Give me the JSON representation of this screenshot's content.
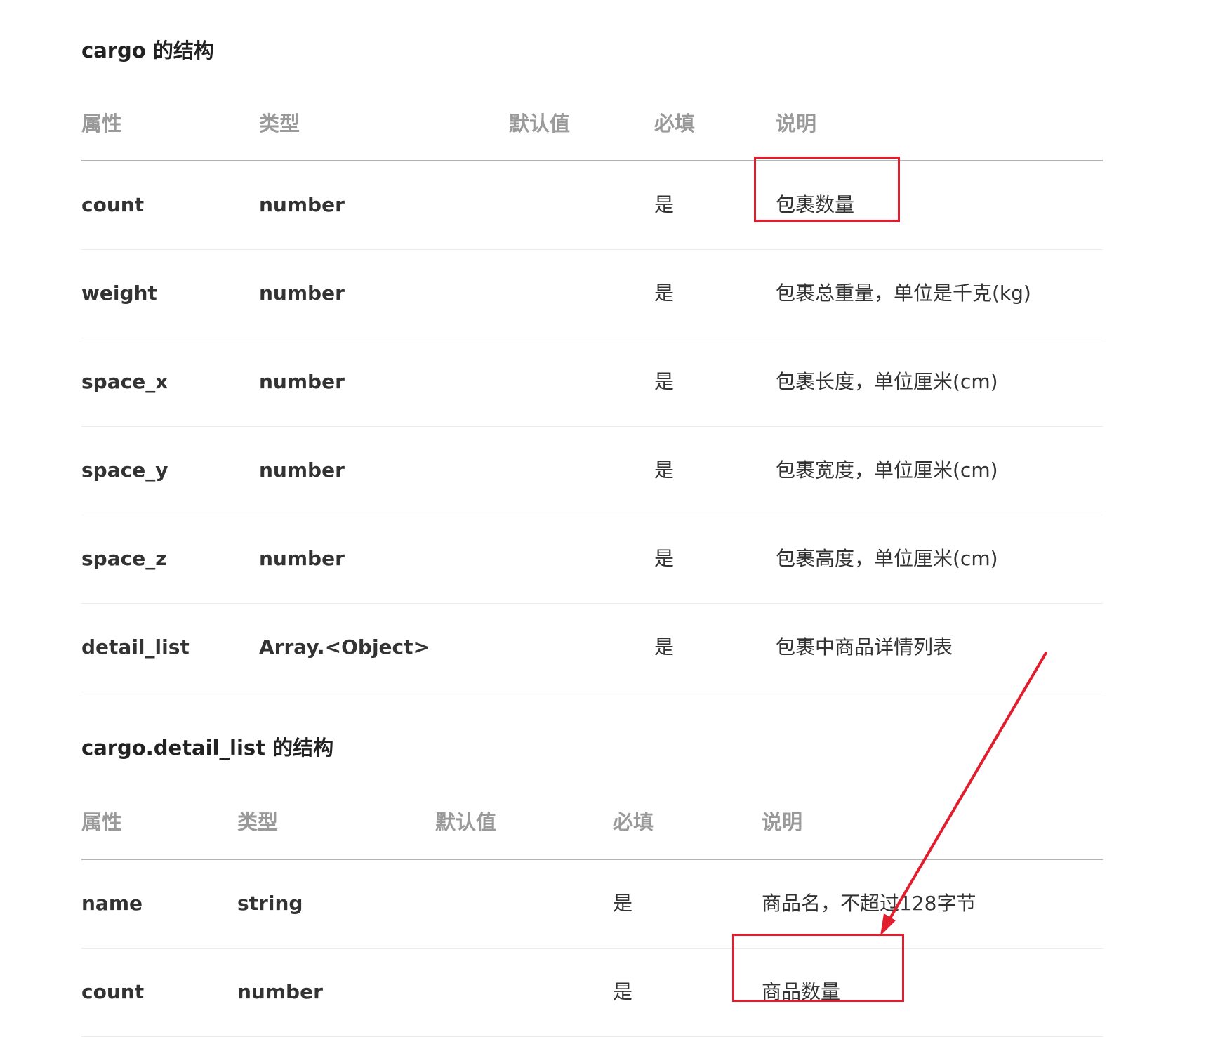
{
  "sections": [
    {
      "title": "cargo 的结构",
      "headers": [
        "属性",
        "类型",
        "默认值",
        "必填",
        "说明"
      ],
      "rows": [
        {
          "attr": "count",
          "type": "number",
          "default": "",
          "required": "是",
          "desc": "包裹数量"
        },
        {
          "attr": "weight",
          "type": "number",
          "default": "",
          "required": "是",
          "desc": "包裹总重量，单位是千克(kg)"
        },
        {
          "attr": "space_x",
          "type": "number",
          "default": "",
          "required": "是",
          "desc": "包裹长度，单位厘米(cm)"
        },
        {
          "attr": "space_y",
          "type": "number",
          "default": "",
          "required": "是",
          "desc": "包裹宽度，单位厘米(cm)"
        },
        {
          "attr": "space_z",
          "type": "number",
          "default": "",
          "required": "是",
          "desc": "包裹高度，单位厘米(cm)"
        },
        {
          "attr": "detail_list",
          "type": "Array.<Object>",
          "default": "",
          "required": "是",
          "desc": "包裹中商品详情列表"
        }
      ]
    },
    {
      "title": "cargo.detail_list 的结构",
      "headers": [
        "属性",
        "类型",
        "默认值",
        "必填",
        "说明"
      ],
      "rows": [
        {
          "attr": "name",
          "type": "string",
          "default": "",
          "required": "是",
          "desc": "商品名，不超过128字节"
        },
        {
          "attr": "count",
          "type": "number",
          "default": "",
          "required": "是",
          "desc": "商品数量"
        }
      ]
    }
  ],
  "annotations": {
    "highlight_color": "#e11d2e",
    "highlighted_cells": [
      "包裹数量",
      "商品数量"
    ],
    "arrow": "arrow-icon"
  }
}
